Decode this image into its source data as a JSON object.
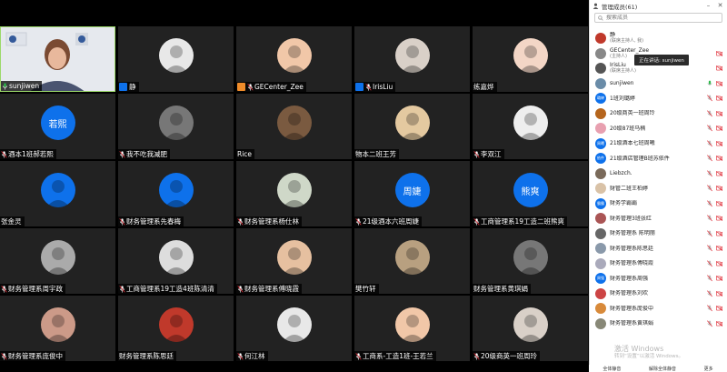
{
  "gallery": {
    "tiles": [
      {
        "name": "sunjiwen",
        "kind": "video",
        "badge": "",
        "mic": "on"
      },
      {
        "name": "静",
        "kind": "photo",
        "badge": "host",
        "mic": ""
      },
      {
        "name": "GECenter_Zee",
        "kind": "photo",
        "badge": "cohost",
        "mic": "muted"
      },
      {
        "name": "IrisLiu",
        "kind": "photo",
        "badge": "host2",
        "mic": "muted"
      },
      {
        "name": "练嘉烨",
        "kind": "photo",
        "badge": "",
        "mic": ""
      },
      {
        "name": "",
        "kind": "blank",
        "badge": "",
        "mic": ""
      },
      {
        "name": "酒本1班郝若熙",
        "kind": "text",
        "avatar_text": "若熙",
        "badge": "",
        "mic": "muted"
      },
      {
        "name": "我不吃我减肥",
        "kind": "photo",
        "badge": "",
        "mic": "muted"
      },
      {
        "name": "Rice",
        "kind": "photo",
        "badge": "",
        "mic": ""
      },
      {
        "name": "物本二班王芳",
        "kind": "photo",
        "badge": "",
        "mic": ""
      },
      {
        "name": "李双江",
        "kind": "photo",
        "badge": "",
        "mic": "muted"
      },
      {
        "name": "",
        "kind": "blank",
        "badge": "",
        "mic": ""
      },
      {
        "name": "张金灵",
        "kind": "photo",
        "badge": "",
        "mic": ""
      },
      {
        "name": "财务管理系先春梅",
        "kind": "photo",
        "badge": "",
        "mic": "muted"
      },
      {
        "name": "财务管理系杨仕林",
        "kind": "photo",
        "badge": "",
        "mic": "muted"
      },
      {
        "name": "21级酒本六班周婕",
        "kind": "text",
        "avatar_text": "周婕",
        "badge": "",
        "mic": "muted"
      },
      {
        "name": "工商管理系19工造二班熊爽",
        "kind": "text",
        "avatar_text": "熊爽",
        "badge": "",
        "mic": "muted"
      },
      {
        "name": "",
        "kind": "blank",
        "badge": "",
        "mic": ""
      },
      {
        "name": "财务管理系周宇政",
        "kind": "photo",
        "badge": "",
        "mic": "muted"
      },
      {
        "name": "工商管理系19工造4班陈清清",
        "kind": "photo",
        "badge": "",
        "mic": "muted"
      },
      {
        "name": "财务管理系傅晓霞",
        "kind": "photo",
        "badge": "",
        "mic": "muted"
      },
      {
        "name": "樊竹轩",
        "kind": "photo",
        "badge": "",
        "mic": ""
      },
      {
        "name": "财务管理系黄琪娟",
        "kind": "photo",
        "badge": "",
        "mic": ""
      },
      {
        "name": "",
        "kind": "blank",
        "badge": "",
        "mic": ""
      },
      {
        "name": "财务管理系庞俊中",
        "kind": "photo",
        "badge": "",
        "mic": "muted"
      },
      {
        "name": "财务管理系陈思廷",
        "kind": "photo",
        "badge": "",
        "mic": ""
      },
      {
        "name": "何江林",
        "kind": "photo",
        "badge": "",
        "mic": "muted"
      },
      {
        "name": "工商系-工造1班-王若兰",
        "kind": "photo",
        "badge": "",
        "mic": "muted"
      },
      {
        "name": "20级商英一班周玲",
        "kind": "photo",
        "badge": "",
        "mic": "muted"
      },
      {
        "name": "",
        "kind": "blank",
        "badge": "",
        "mic": ""
      }
    ]
  },
  "panel": {
    "title": "管理成员(61)",
    "search_placeholder": "搜索成员",
    "tooltip": "正在讲话: sunjiwen",
    "participants": [
      {
        "name": "静",
        "sub": "(联席主持人, 我)",
        "avatar": "photo",
        "color": "#c0392b"
      },
      {
        "name": "GECenter_Zee",
        "sub": "(主持人)",
        "avatar": "photo",
        "color": "#888"
      },
      {
        "name": "IrisLiu",
        "sub": "(联席主持人)",
        "avatar": "photo",
        "color": "#555"
      },
      {
        "name": "sunjiwen",
        "sub": "",
        "avatar": "photo",
        "color": "#6a8ca8"
      },
      {
        "name": "1班刘璐婷",
        "sub": "",
        "avatar": "text",
        "avatar_text": "璐婷"
      },
      {
        "name": "20级商英一班周玲",
        "sub": "",
        "avatar": "photo",
        "color": "#b5651d"
      },
      {
        "name": "20级87班马楠",
        "sub": "",
        "avatar": "photo",
        "color": "#e8a0b0"
      },
      {
        "name": "21级酒本七班周曦",
        "sub": "",
        "avatar": "text",
        "avatar_text": "周曦"
      },
      {
        "name": "21级酒店管理B班苏依件",
        "sub": "",
        "avatar": "text",
        "avatar_text": "依件"
      },
      {
        "name": "Liebzch.",
        "sub": "",
        "avatar": "photo",
        "color": "#7a6a5a"
      },
      {
        "name": "财管二班王柏婷",
        "sub": "",
        "avatar": "photo",
        "color": "#d9c2a7"
      },
      {
        "name": "财务学霸霸",
        "sub": "",
        "avatar": "text",
        "avatar_text": "霸霸"
      },
      {
        "name": "财务管理3班张红",
        "sub": "",
        "avatar": "photo",
        "color": "#a55"
      },
      {
        "name": "财务管理系 陈明丽",
        "sub": "",
        "avatar": "photo",
        "color": "#666"
      },
      {
        "name": "财务管理系陈思廷",
        "sub": "",
        "avatar": "photo",
        "color": "#8a99aa"
      },
      {
        "name": "财务管理系傅晓霞",
        "sub": "",
        "avatar": "photo",
        "color": "#aab"
      },
      {
        "name": "财务管理系周强",
        "sub": "",
        "avatar": "text",
        "avatar_text": "周强"
      },
      {
        "name": "财务管理系刘欢",
        "sub": "",
        "avatar": "photo",
        "color": "#c44"
      },
      {
        "name": "财务管理系庞俊中",
        "sub": "",
        "avatar": "photo",
        "color": "#d88a3a"
      },
      {
        "name": "财务管理系黄琪娟",
        "sub": "",
        "avatar": "photo",
        "color": "#887"
      }
    ],
    "watermark_line1": "激活 Windows",
    "watermark_line2": "转到“设置”以激活 Windows。",
    "btn_mute_all": "全体静音",
    "btn_unmute_all": "解除全体静音",
    "btn_more": "更多"
  },
  "colors": {
    "accent": "#0e71eb",
    "muted": "#e0303a",
    "speaking": "#2db84b"
  }
}
